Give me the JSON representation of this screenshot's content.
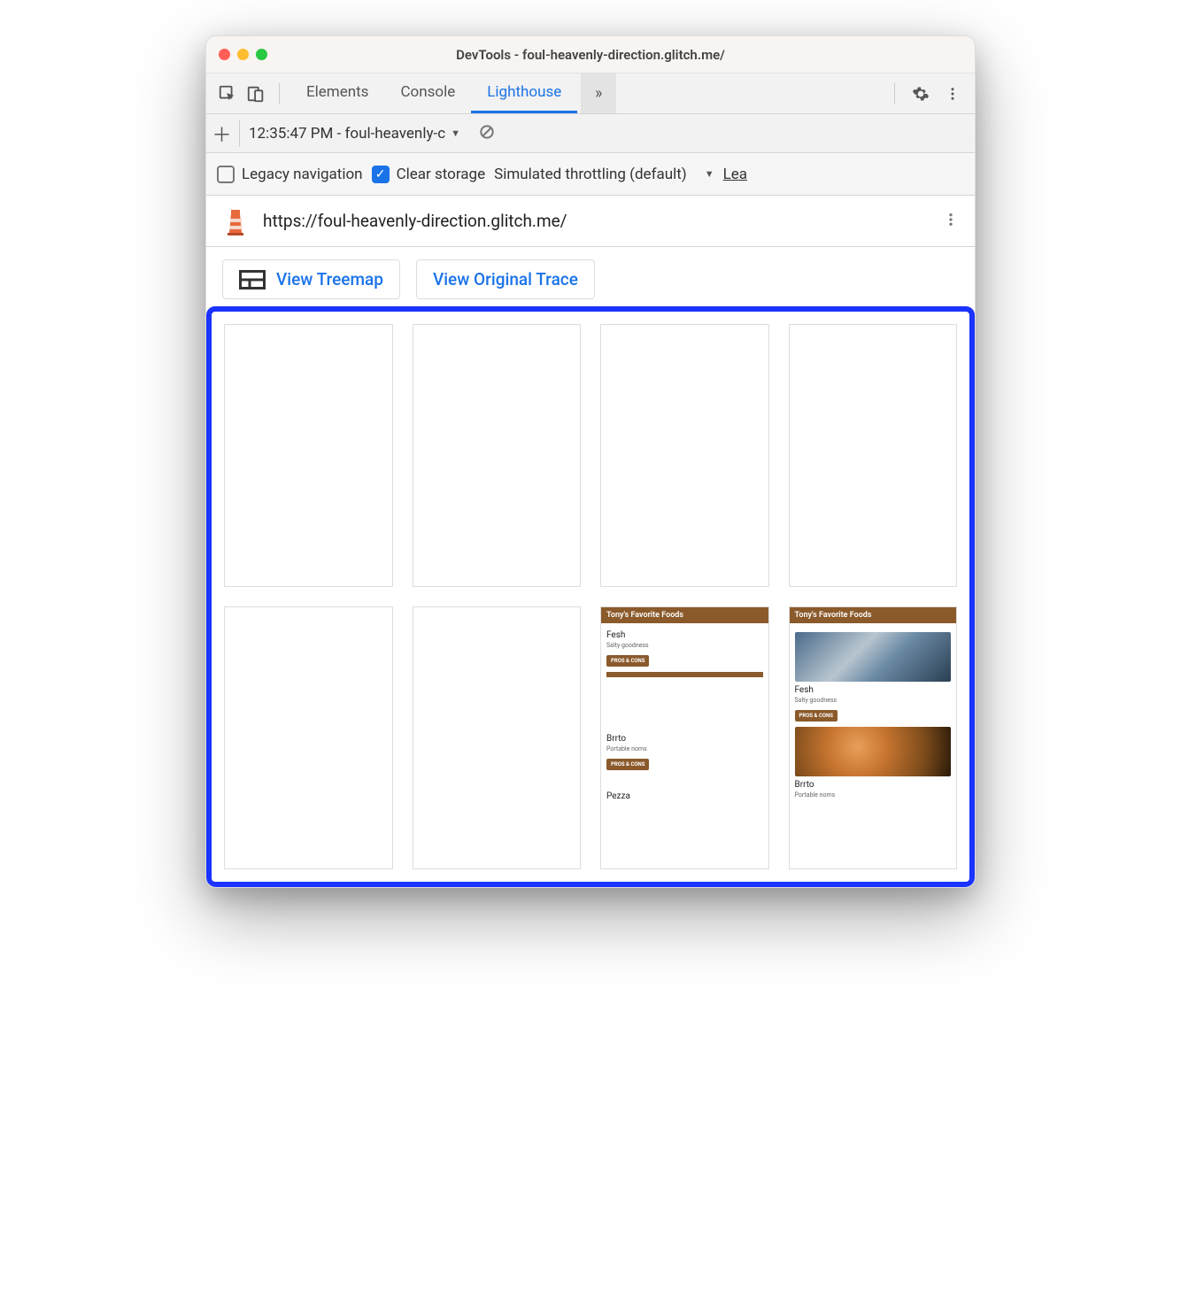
{
  "window": {
    "title": "DevTools - foul-heavenly-direction.glitch.me/"
  },
  "tabs": {
    "elements": "Elements",
    "console": "Console",
    "lighthouse": "Lighthouse"
  },
  "report_bar": {
    "selected": "12:35:47 PM - foul-heavenly-c"
  },
  "options": {
    "legacy_nav": "Legacy navigation",
    "clear_storage": "Clear storage",
    "throttling": "Simulated throttling (default)",
    "learn_trunc": "Lea"
  },
  "urlbar": {
    "url": "https://foul-heavenly-direction.glitch.me/"
  },
  "actions": {
    "treemap": "View Treemap",
    "trace": "View Original Trace"
  },
  "thumbs": {
    "header": "Tony's Favorite Foods",
    "items": [
      {
        "title": "Fesh",
        "sub": "Salty goodness",
        "badge": "PROS & CONS"
      },
      {
        "title": "Brrto",
        "sub": "Portable noms",
        "badge": "PROS & CONS"
      },
      {
        "title": "Pezza",
        "sub": ""
      }
    ]
  }
}
